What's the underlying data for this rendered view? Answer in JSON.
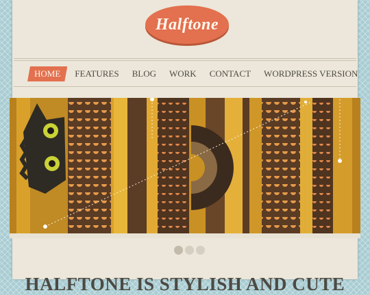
{
  "site": {
    "logo_text": "Halftone"
  },
  "nav": {
    "items": [
      {
        "label": "HOME",
        "active": true
      },
      {
        "label": "FEATURES",
        "active": false
      },
      {
        "label": "BLOG",
        "active": false
      },
      {
        "label": "WORK",
        "active": false
      },
      {
        "label": "CONTACT",
        "active": false
      },
      {
        "label": "WORDPRESS VERSION",
        "active": false
      }
    ]
  },
  "slider": {
    "slide_count": 3,
    "current_slide": 1
  },
  "main": {
    "headline": "HALFTONE IS STYLISH AND CUTE"
  },
  "colors": {
    "accent": "#e3704f",
    "page_bg": "#ece7da",
    "outer_bg": "#a9cdd3",
    "text": "#4d4a43"
  }
}
